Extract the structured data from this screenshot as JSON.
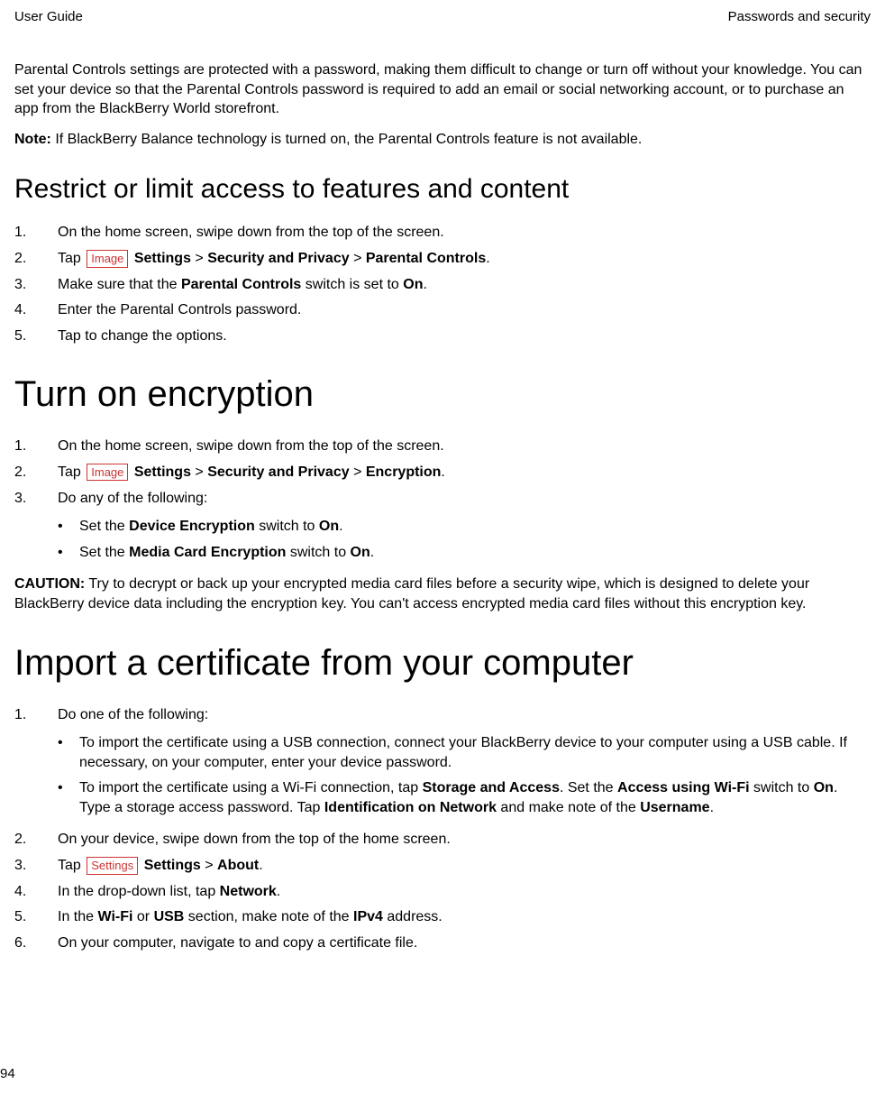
{
  "header": {
    "left": "User Guide",
    "right": "Passwords and security"
  },
  "intro": "Parental Controls settings are protected with a password, making them difficult to change or turn off without your knowledge. You can set your device so that the Parental Controls password is required to add an email or social networking account, or to purchase an app from the BlackBerry World storefront.",
  "note": {
    "label": "Note:",
    "text": " If BlackBerry Balance technology is turned on, the Parental Controls feature is not available."
  },
  "section1": {
    "title": "Restrict or limit access to features and content",
    "step1": "On the home screen, swipe down from the top of the screen.",
    "step2_pre": "Tap ",
    "image_label": "Image",
    "step2_b1": "Settings",
    "step2_gt": " > ",
    "step2_b2": "Security and Privacy",
    "step2_b3": "Parental Controls",
    "step2_end": ".",
    "step3_pre": "Make sure that the ",
    "step3_b1": "Parental Controls",
    "step3_mid": " switch is set to ",
    "step3_b2": "On",
    "step3_end": ".",
    "step4": "Enter the Parental Controls password.",
    "step5": "Tap to change the options."
  },
  "section2": {
    "title": "Turn on encryption",
    "step1": "On the home screen, swipe down from the top of the screen.",
    "step2_pre": "Tap ",
    "image_label": "Image",
    "step2_b1": "Settings",
    "step2_gt": " > ",
    "step2_b2": "Security and Privacy",
    "step2_b3": "Encryption",
    "step2_end": ".",
    "step3": "Do any of the following:",
    "bullet1_pre": "Set the ",
    "bullet1_b1": "Device Encryption",
    "bullet1_mid": " switch to ",
    "bullet1_b2": "On",
    "bullet1_end": ".",
    "bullet2_pre": "Set the ",
    "bullet2_b1": "Media Card Encryption",
    "bullet2_mid": " switch to ",
    "bullet2_b2": "On",
    "bullet2_end": ".",
    "caution_label": "CAUTION:",
    "caution_text": " Try to decrypt or back up your encrypted media card files before a security wipe, which is designed to delete your BlackBerry device data including the encryption key. You can't access encrypted media card files without this encryption key."
  },
  "section3": {
    "title": "Import a certificate from your computer",
    "step1": "Do one of the following:",
    "bullet1": "To import the certificate using a USB connection, connect your BlackBerry device to your computer using a USB cable. If necessary, on your computer, enter your device password.",
    "bullet2_pre": "To import the certificate using a Wi-Fi connection, tap ",
    "bullet2_b1": "Storage and Access",
    "bullet2_mid1": ". Set the ",
    "bullet2_b2": "Access using Wi-Fi",
    "bullet2_mid2": " switch to ",
    "bullet2_b3": "On",
    "bullet2_mid3": ". Type a storage access password. Tap ",
    "bullet2_b4": "Identification on Network",
    "bullet2_mid4": " and make note of the ",
    "bullet2_b5": "Username",
    "bullet2_end": ".",
    "step2": "On your device, swipe down from the top of the home screen.",
    "step3_pre": "Tap ",
    "settings_img": "Settings",
    "step3_b1": "Settings",
    "step3_gt": " > ",
    "step3_b2": "About",
    "step3_end": ".",
    "step4_pre": "In the drop-down list, tap ",
    "step4_b1": "Network",
    "step4_end": ".",
    "step5_pre": "In the ",
    "step5_b1": "Wi-Fi",
    "step5_mid1": " or ",
    "step5_b2": "USB",
    "step5_mid2": " section, make note of the ",
    "step5_b3": "IPv4",
    "step5_end": " address.",
    "step6": "On your computer, navigate to and copy a certificate file."
  },
  "page_number": "94"
}
